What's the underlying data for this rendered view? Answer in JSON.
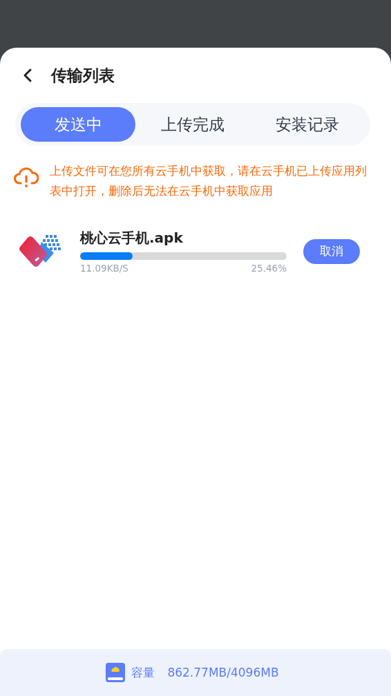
{
  "header": {
    "title": "传输列表"
  },
  "tabs": [
    {
      "label": "发送中",
      "selected": true
    },
    {
      "label": "上传完成",
      "selected": false
    },
    {
      "label": "安装记录",
      "selected": false
    }
  ],
  "notice": "上传文件可在您所有云手机中获取，请在云手机已上传应用列表中打开，删除后无法在云手机中获取应用",
  "transfers": [
    {
      "name": "桃心云手机.apk",
      "level": 0.2546,
      "speed": "11.09KB/S",
      "percent": "25.46%",
      "action": "取消"
    }
  ],
  "footer": {
    "label": "容量",
    "value": "862.77MB/4096MB"
  }
}
